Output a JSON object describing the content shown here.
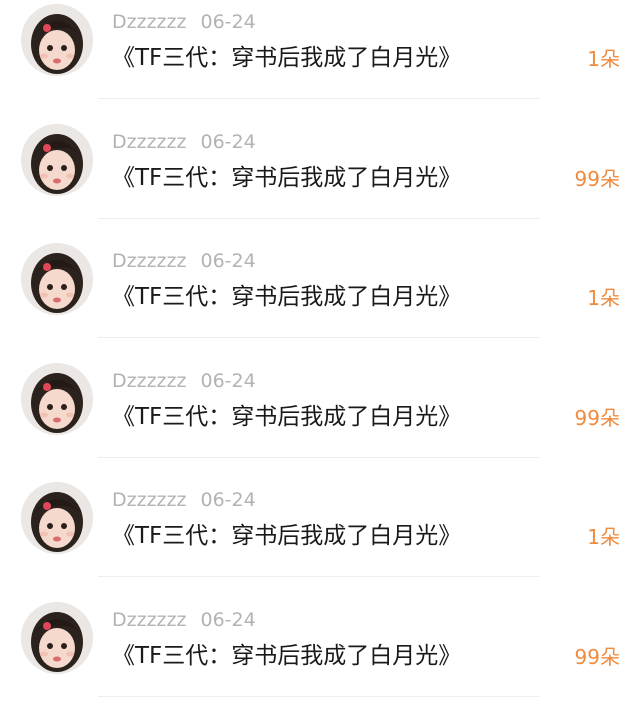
{
  "items": [
    {
      "user": "Dzzzzzz",
      "date": "06-24",
      "title": "《TF三代：穿书后我成了白月光》",
      "count": "1朵",
      "avatar": "child-photo-avatar"
    },
    {
      "user": "Dzzzzzz",
      "date": "06-24",
      "title": "《TF三代：穿书后我成了白月光》",
      "count": "99朵",
      "avatar": "child-photo-avatar"
    },
    {
      "user": "Dzzzzzz",
      "date": "06-24",
      "title": "《TF三代：穿书后我成了白月光》",
      "count": "1朵",
      "avatar": "child-photo-avatar"
    },
    {
      "user": "Dzzzzzz",
      "date": "06-24",
      "title": "《TF三代：穿书后我成了白月光》",
      "count": "99朵",
      "avatar": "child-photo-avatar"
    },
    {
      "user": "Dzzzzzz",
      "date": "06-24",
      "title": "《TF三代：穿书后我成了白月光》",
      "count": "1朵",
      "avatar": "child-photo-avatar"
    },
    {
      "user": "Dzzzzzz",
      "date": "06-24",
      "title": "《TF三代：穿书后我成了白月光》",
      "count": "99朵",
      "avatar": "child-photo-avatar"
    }
  ],
  "colors": {
    "count": "#f08a3c",
    "meta": "#b3b3b3",
    "title": "#1a1a1a",
    "divider": "#eeeeee"
  }
}
